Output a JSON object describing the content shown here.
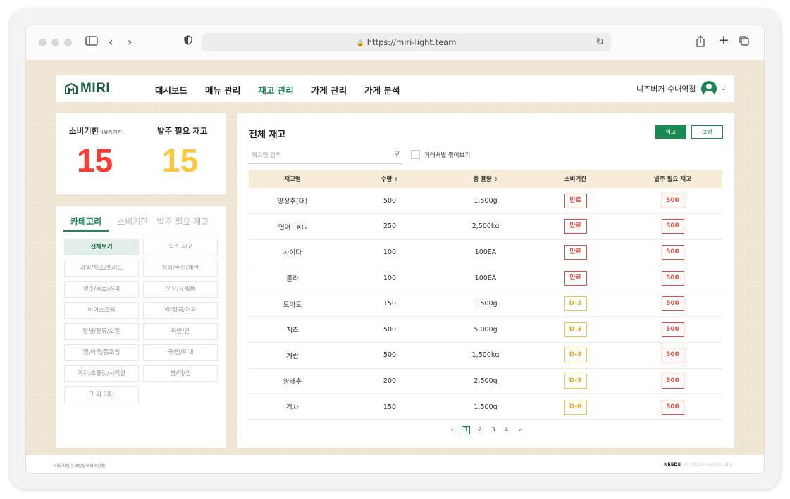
{
  "browser": {
    "url": "https://miri-light.team"
  },
  "header": {
    "logo": "MIRI",
    "menu": [
      "대시보드",
      "메뉴 관리",
      "재고 관리",
      "가게 관리",
      "가게 분석"
    ],
    "active_menu_index": 2,
    "user_name": "니즈버거 수내역점"
  },
  "summary": {
    "expiry_label": "소비기한",
    "expiry_sub": "(유통기한)",
    "expiry_count": "15",
    "reorder_label": "발주 필요 재고",
    "reorder_count": "15",
    "expiry_color": "#ff3b2f",
    "reorder_color": "#ffc83d"
  },
  "category": {
    "tabs": [
      "카테고리",
      "소비기한",
      "발주 필요 재고"
    ],
    "active_tab": 0,
    "items": [
      "전체보기",
      "믹스 재고",
      "과일/채소/샐러드",
      "정육/수산/계란",
      "생수/음료/커피",
      "우유/유제품",
      "아이스크림",
      "쌀/잡곡/견과",
      "양념/장류/오일",
      "라면/면",
      "햄/어묵/통조림",
      "국/탕/찌개",
      "과자/초콜릿/시리얼",
      "빵/떡/잼",
      "그 외 기타"
    ],
    "active_item": 0
  },
  "inventory": {
    "title": "전체 재고",
    "btn_in": "입고",
    "btn_adjust": "보정",
    "search_placeholder": "재고명 검색",
    "group_label": "거래처별 묶어보기",
    "columns": [
      "재고명",
      "수량",
      "총 용량",
      "소비기한",
      "발주 필요 재고"
    ],
    "rows": [
      {
        "name": "양상추(대)",
        "qty": "500",
        "volume": "1,500g",
        "expiry": "만료",
        "order": "500"
      },
      {
        "name": "연어 1KG",
        "qty": "250",
        "volume": "2,500kg",
        "expiry": "만료",
        "order": "500"
      },
      {
        "name": "사이다",
        "qty": "100",
        "volume": "100EA",
        "expiry": "만료",
        "order": "500"
      },
      {
        "name": "콜라",
        "qty": "100",
        "volume": "100EA",
        "expiry": "만료",
        "order": "500"
      },
      {
        "name": "토마토",
        "qty": "150",
        "volume": "1,500g",
        "expiry": "D-3",
        "order": "500"
      },
      {
        "name": "치즈",
        "qty": "500",
        "volume": "5,000g",
        "expiry": "D-3",
        "order": "500"
      },
      {
        "name": "계란",
        "qty": "500",
        "volume": "1,500kg",
        "expiry": "D-3",
        "order": "500"
      },
      {
        "name": "양배추",
        "qty": "200",
        "volume": "2,500g",
        "expiry": "D-3",
        "order": "500"
      },
      {
        "name": "감자",
        "qty": "150",
        "volume": "1,500g",
        "expiry": "D-6",
        "order": "500"
      }
    ],
    "pages": [
      "1",
      "2",
      "3",
      "4"
    ],
    "current_page": "1"
  },
  "footer": {
    "terms": "이용약관",
    "privacy": "개인정보처리방침",
    "brand": "NEEDS",
    "copyright": "© 2023 creativeLabs."
  }
}
